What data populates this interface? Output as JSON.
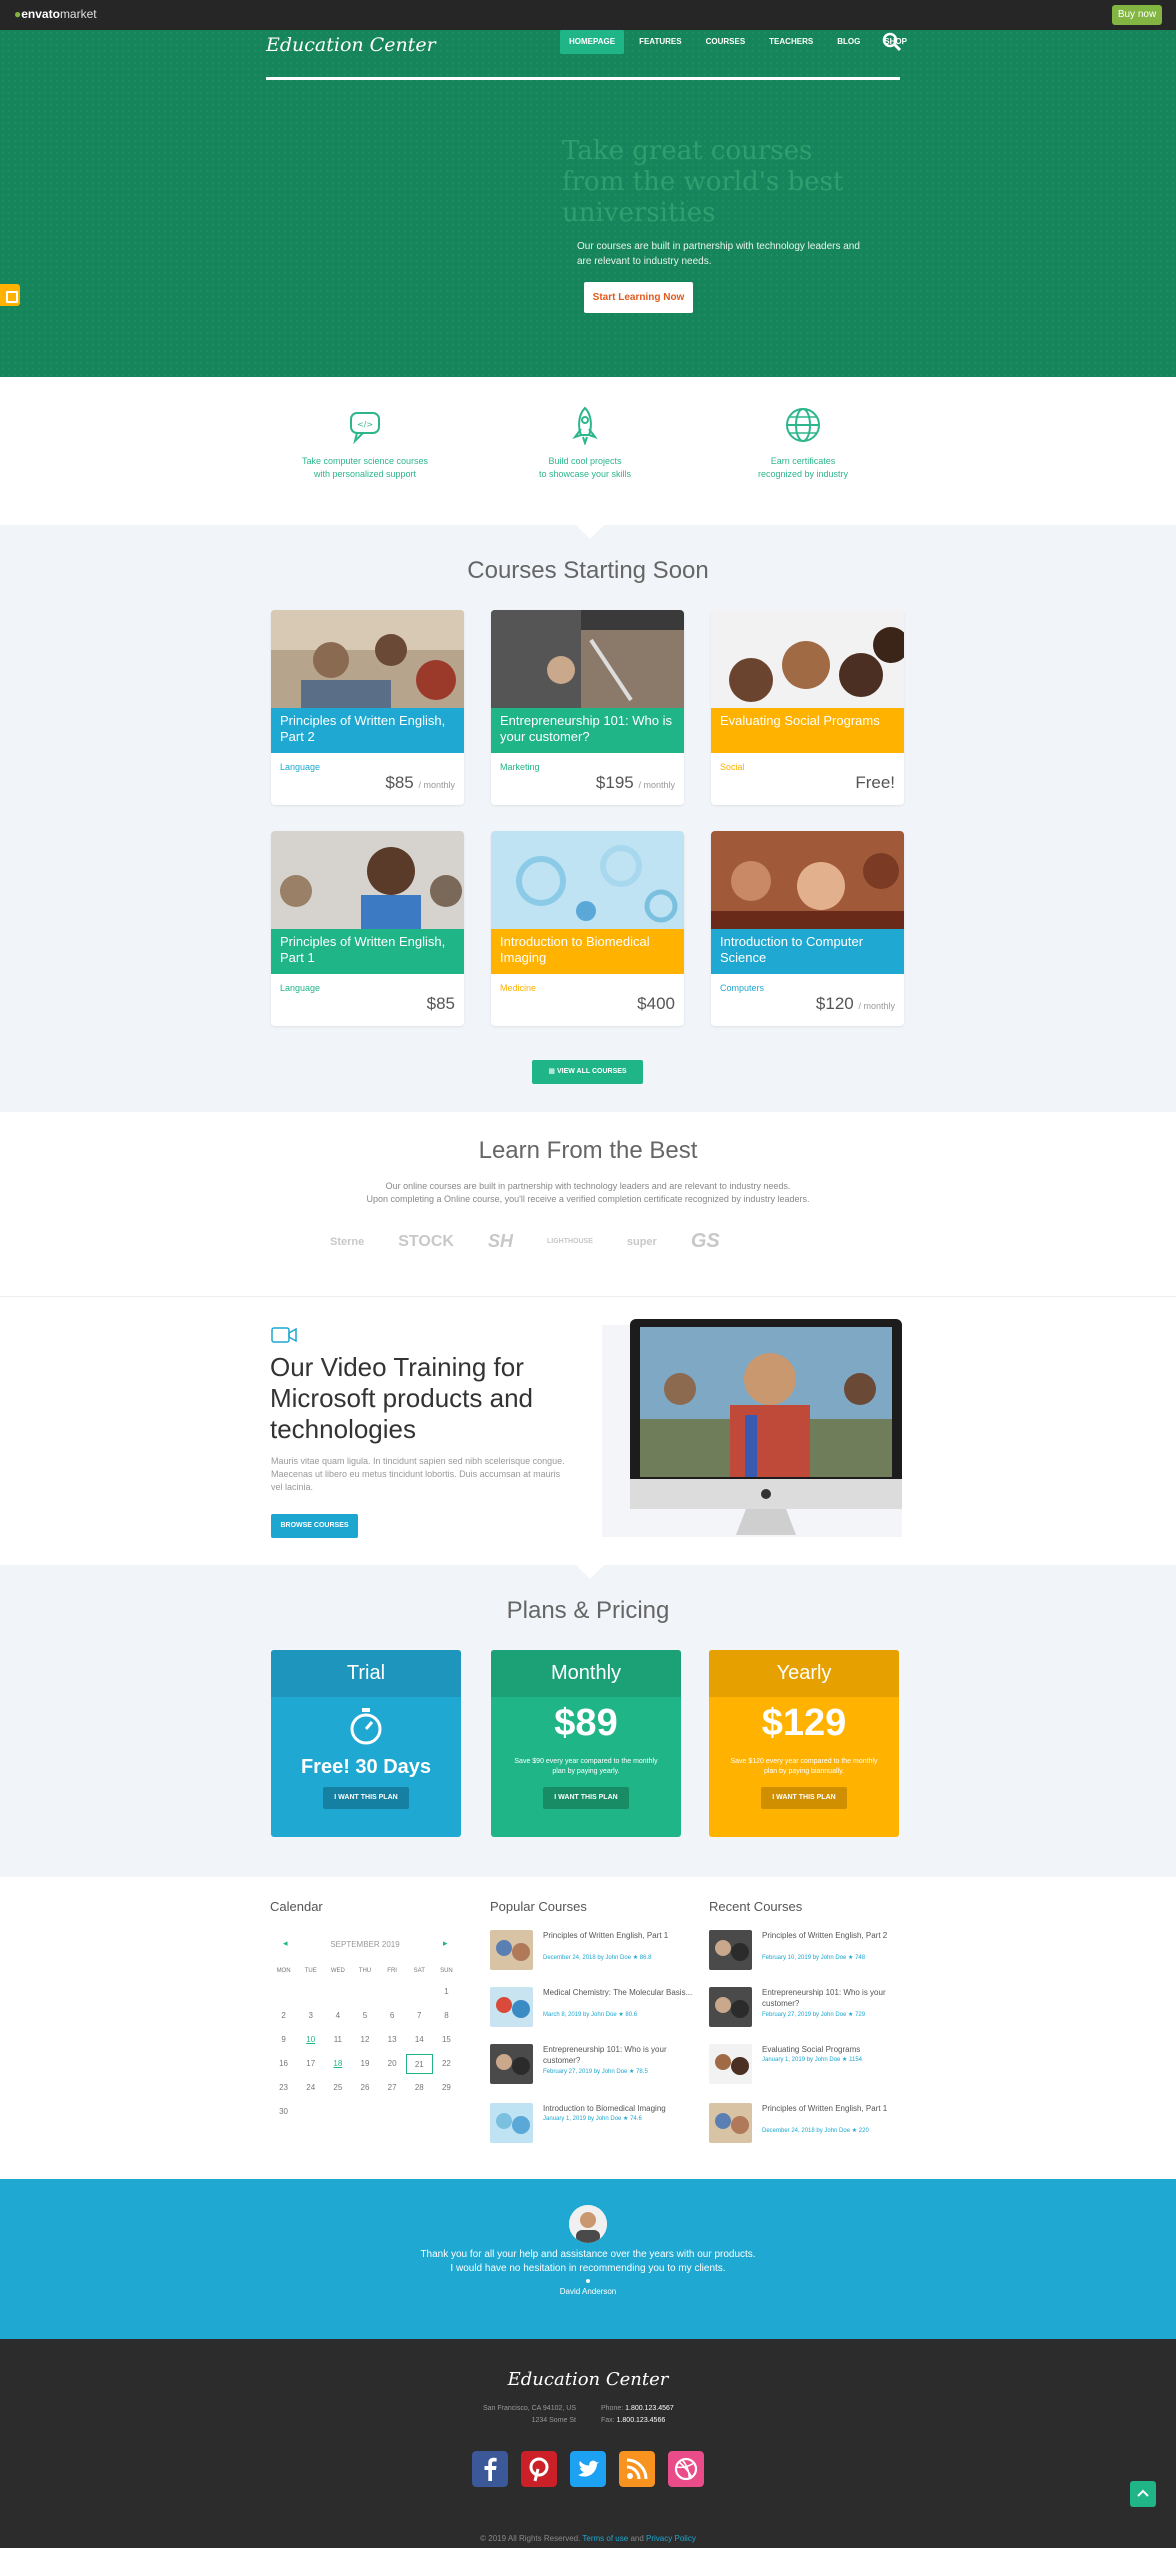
{
  "envato": {
    "brand": "envato",
    "brand_suffix": "market",
    "buy": "Buy now"
  },
  "header": {
    "logo": "Education Center",
    "nav": [
      "HOMEPAGE",
      "FEATURES",
      "COURSES",
      "TEACHERS",
      "BLOG",
      "SHOP"
    ],
    "active_nav": "HOMEPAGE"
  },
  "hero": {
    "title": "Take great courses from the world's best universities",
    "subtitle": "Our courses are built in partnership with technology leaders and are relevant to industry needs.",
    "cta": "Start Learning Now"
  },
  "features": [
    {
      "icon": "chat-icon",
      "line1": "Take computer science courses",
      "line2": "with personalized support"
    },
    {
      "icon": "rocket-icon",
      "line1": "Build cool projects",
      "line2": "to showcase your skills"
    },
    {
      "icon": "globe-icon",
      "line1": "Earn certificates",
      "line2": "recognized by industry"
    }
  ],
  "courses": {
    "title": "Courses Starting Soon",
    "items": [
      {
        "title": "Principles of Written English, Part 2",
        "category": "Language",
        "price": "$85",
        "per": "/ monthly",
        "color": "#1fa8d1"
      },
      {
        "title": "Entrepreneurship 101: Who is your customer?",
        "category": "Marketing",
        "price": "$195",
        "per": "/ monthly",
        "color": "#20b586"
      },
      {
        "title": "Evaluating Social Programs",
        "category": "Social",
        "price": "Free!",
        "per": "",
        "color": "#ffb200"
      },
      {
        "title": "Principles of Written English, Part 1",
        "category": "Language",
        "price": "$85",
        "per": "",
        "color": "#20b586"
      },
      {
        "title": "Introduction to Biomedical Imaging",
        "category": "Medicine",
        "price": "$400",
        "per": "",
        "color": "#ffb200"
      },
      {
        "title": "Introduction to Computer Science",
        "category": "Computers",
        "price": "$120",
        "per": "/ monthly",
        "color": "#1fa8d1"
      }
    ],
    "view_all": "VIEW ALL COURSES"
  },
  "learn": {
    "title": "Learn From the Best",
    "line1": "Our online courses are built in partnership with technology leaders and are relevant to industry needs.",
    "line2": "Upon completing a Online course, you'll receive a verified completion certificate recognized by industry leaders.",
    "logos": [
      "Sterne",
      "STOCK",
      "SH",
      "LIGHTHOUSE",
      "super",
      "GS"
    ]
  },
  "video": {
    "title": "Our Video Training for Microsoft products and technologies",
    "text": "Mauris vitae quam ligula. In tincidunt sapien sed nibh scelerisque congue. Maecenas ut libero eu metus tincidunt lobortis. Duis accumsan at mauris vel lacinia.",
    "button": "BROWSE COURSES"
  },
  "pricing": {
    "title": "Plans & Pricing",
    "plans": [
      {
        "name": "Trial",
        "price": "Free! 30 Days",
        "note": "",
        "button": "I WANT THIS PLAN"
      },
      {
        "name": "Monthly",
        "price": "$89",
        "note": "Save $90 every year compared to the monthly plan by paying yearly.",
        "button": "I WANT THIS PLAN"
      },
      {
        "name": "Yearly",
        "price": "$129",
        "note": "Save $120 every year compared to the monthly plan by paying biannually.",
        "button": "I WANT THIS PLAN"
      }
    ]
  },
  "calendar": {
    "title": "Calendar",
    "month": "SEPTEMBER 2019",
    "weekdays": [
      "MON",
      "TUE",
      "WED",
      "THU",
      "FRI",
      "SAT",
      "SUN"
    ],
    "days": [
      "",
      "",
      "",
      "",
      "",
      "",
      "1",
      "2",
      "3",
      "4",
      "5",
      "6",
      "7",
      "8",
      "9",
      "10",
      "11",
      "12",
      "13",
      "14",
      "15",
      "16",
      "17",
      "18",
      "19",
      "20",
      "21",
      "22",
      "23",
      "24",
      "25",
      "26",
      "27",
      "28",
      "29",
      "30"
    ],
    "link_days": [
      "10",
      "18"
    ],
    "today": "21"
  },
  "popular": {
    "title": "Popular Courses",
    "items": [
      {
        "title": "Principles of Written English, Part 1",
        "meta": "December 24, 2018  by John Doe  ★ 86.8"
      },
      {
        "title": "Medical Chemistry: The Molecular Basis...",
        "meta": "March 8, 2019  by John Doe  ★ 80.6"
      },
      {
        "title": "Entrepreneurship 101: Who is your customer?",
        "meta": "February 27, 2019  by John Doe  ★ 78.5"
      },
      {
        "title": "Introduction to Biomedical Imaging",
        "meta": "January 1, 2019  by John Doe  ★ 74.6"
      }
    ]
  },
  "recent": {
    "title": "Recent Courses",
    "items": [
      {
        "title": "Principles of Written English, Part 2",
        "meta": "February 10, 2019  by John Doe  ★ 748"
      },
      {
        "title": "Entrepreneurship 101: Who is your customer?",
        "meta": "February 27, 2019  by John Doe  ★ 729"
      },
      {
        "title": "Evaluating Social Programs",
        "meta": "January 1, 2019  by John Doe  ★ 1154"
      },
      {
        "title": "Principles of Written English, Part 1",
        "meta": "December 24, 2018  by John Doe  ★ 220"
      }
    ]
  },
  "testimonial": {
    "line1": "Thank you for all your help and assistance over the years with our products.",
    "line2": "I would have no hesitation in recommending you to my clients.",
    "author": "David Anderson"
  },
  "footer": {
    "logo": "Education Center",
    "address1": "San Francisco, CA 94102, US",
    "address2": "1234 Some St",
    "phone_label": "Phone:",
    "phone": "1.800.123.4567",
    "fax_label": "Fax:",
    "fax": "1.800.123.4566",
    "copy_prefix": "© 2019 All Rights Reserved.",
    "terms": "Terms of use",
    "and": "and",
    "privacy": "Privacy Policy"
  },
  "colors": {
    "green": "#17855c",
    "accent_green": "#20b586",
    "blue": "#1fa8d1",
    "yellow": "#ffb200",
    "footer": "#2c2c2c"
  }
}
